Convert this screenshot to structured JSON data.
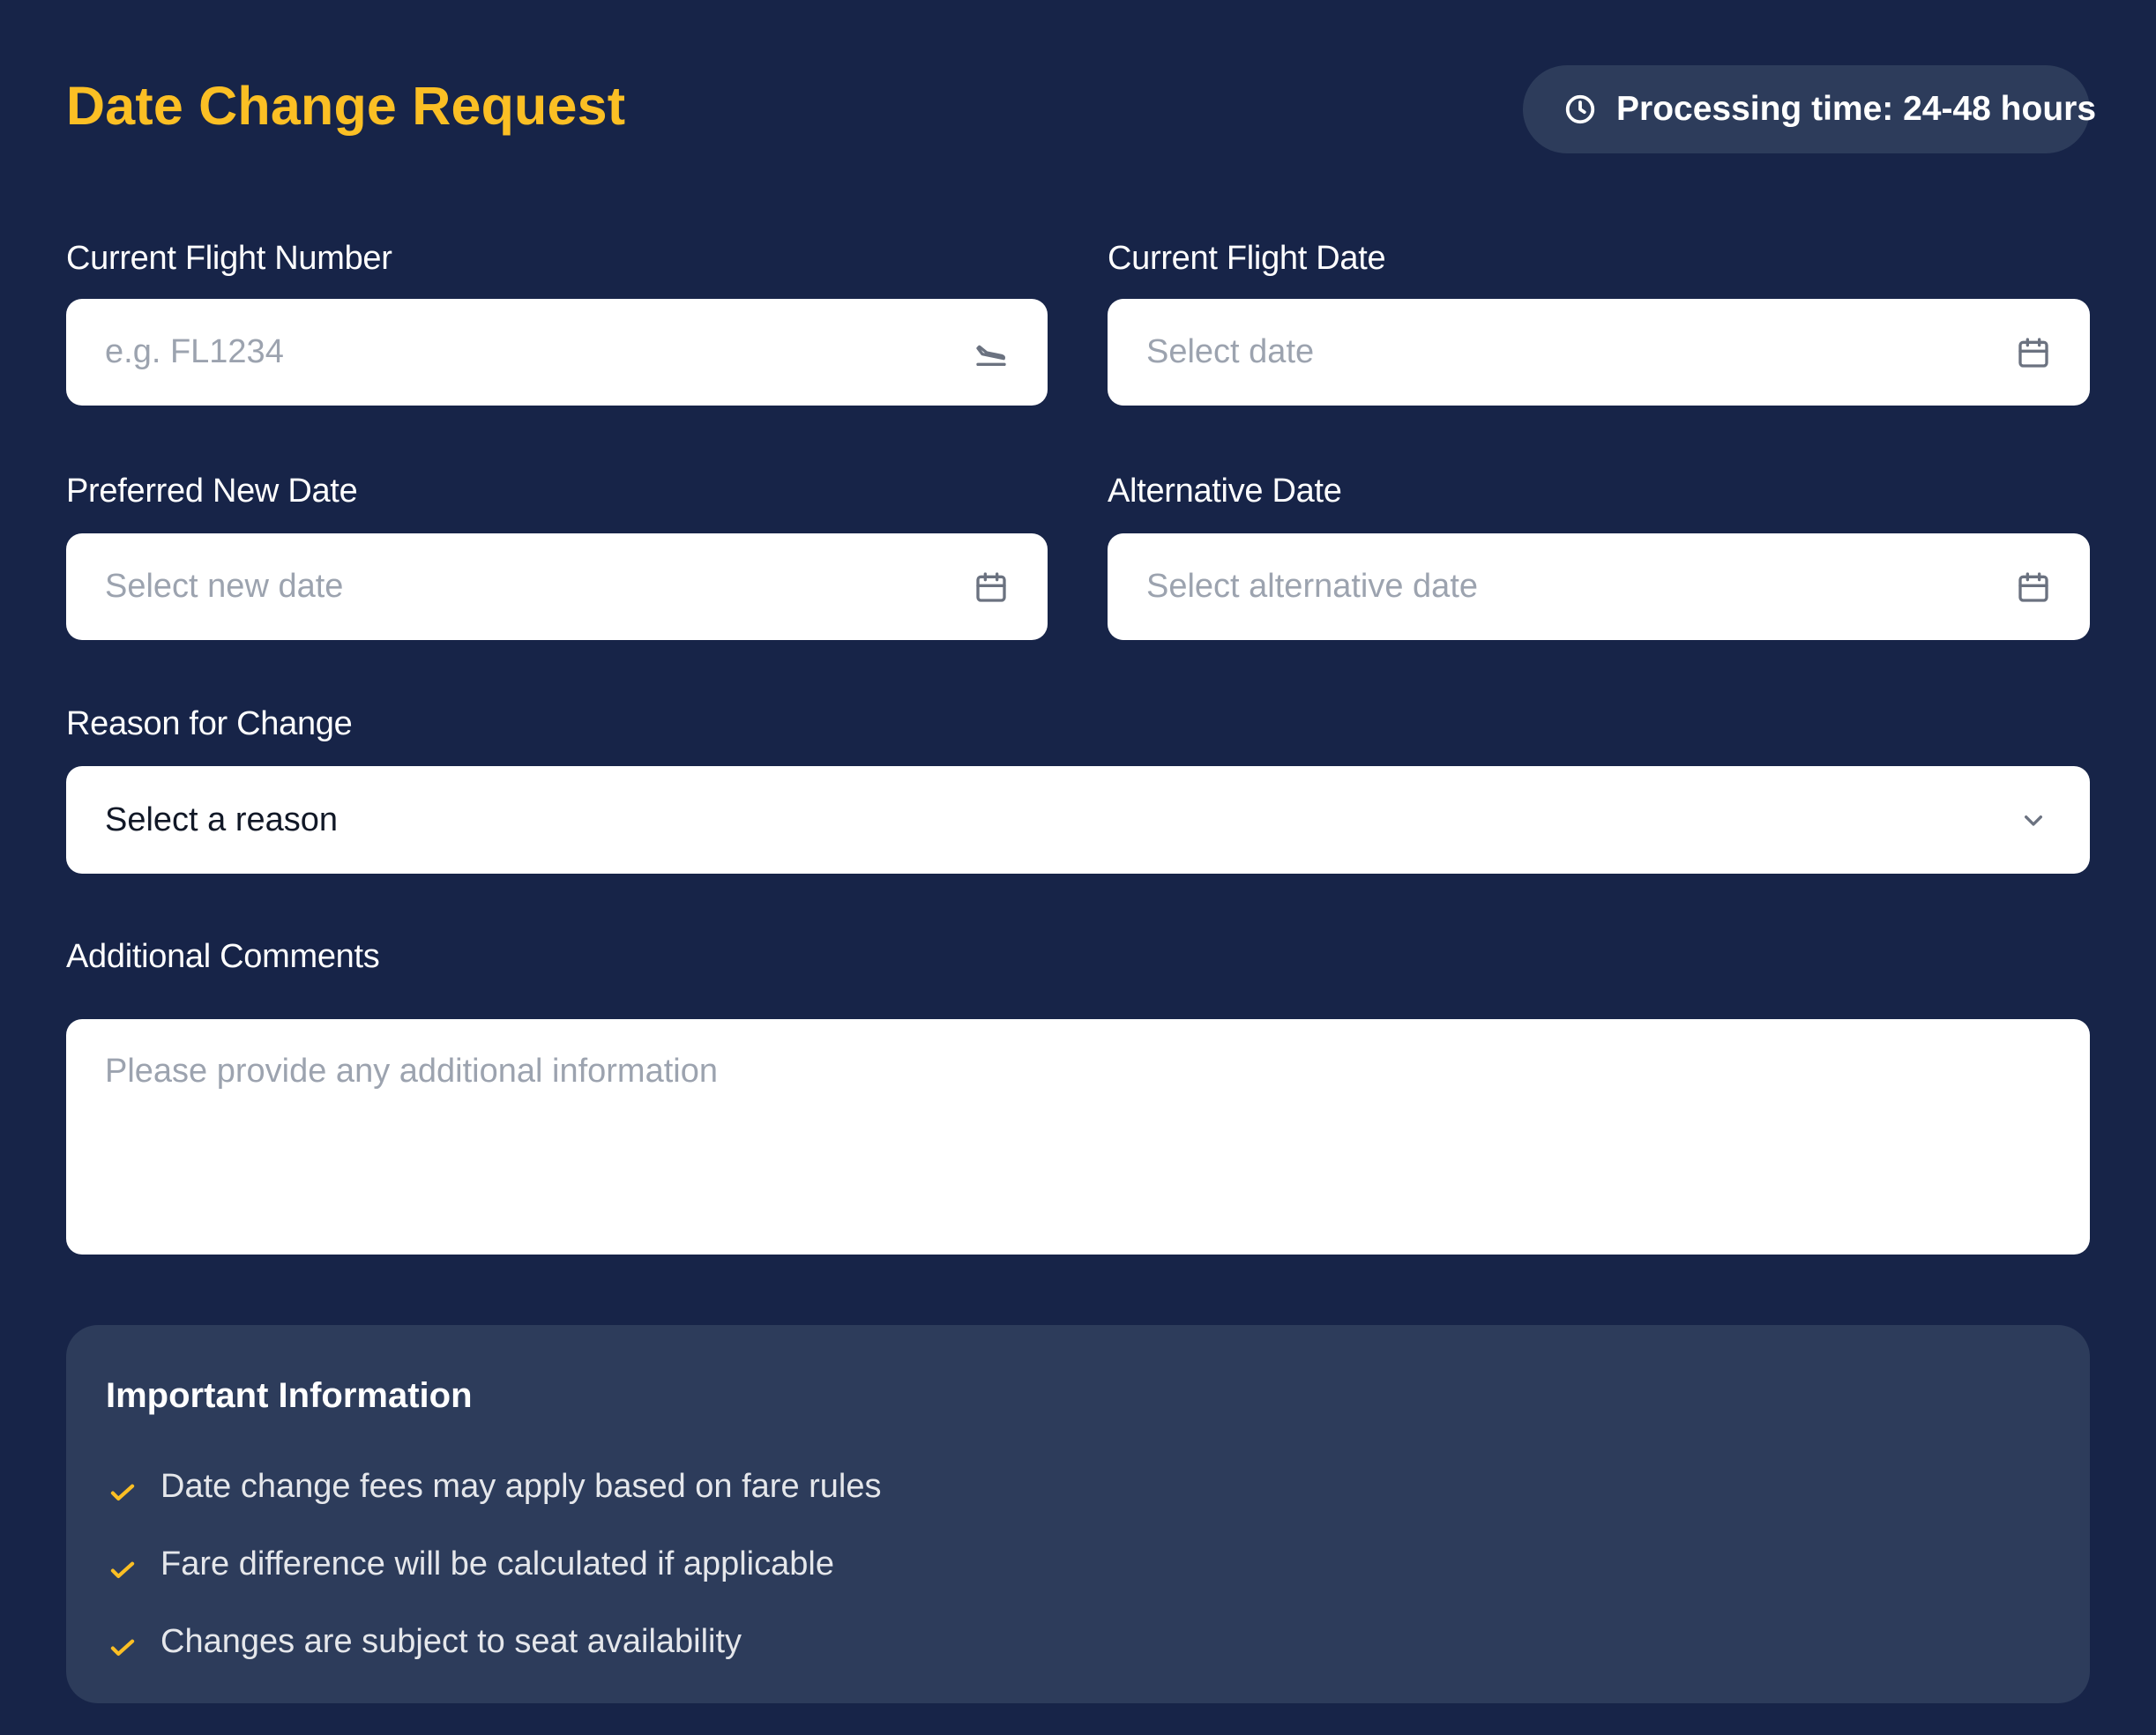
{
  "header": {
    "title": "Date Change Request",
    "processing_badge": "Processing time: 24-48 hours"
  },
  "form": {
    "current_flight_number": {
      "label": "Current Flight Number",
      "placeholder": "e.g. FL1234",
      "icon": "plane-landing-icon"
    },
    "current_flight_date": {
      "label": "Current Flight Date",
      "placeholder": "Select date",
      "icon": "calendar-icon"
    },
    "preferred_new_date": {
      "label": "Preferred New Date",
      "placeholder": "Select new date",
      "icon": "calendar-icon"
    },
    "alternative_date": {
      "label": "Alternative Date",
      "placeholder": "Select alternative date",
      "icon": "calendar-icon"
    },
    "reason": {
      "label": "Reason for Change",
      "selected": "Select a reason",
      "icon": "chevron-down-icon"
    },
    "comments": {
      "label": "Additional Comments",
      "placeholder": "Please provide any additional information"
    }
  },
  "info": {
    "title": "Important Information",
    "items": [
      "Date change fees may apply based on fare rules",
      "Fare difference will be calculated if applicable",
      "Changes are subject to seat availability"
    ]
  },
  "colors": {
    "background": "#172448",
    "accent": "#fbbf24",
    "card": "#2d3c5b",
    "field": "#ffffff"
  }
}
